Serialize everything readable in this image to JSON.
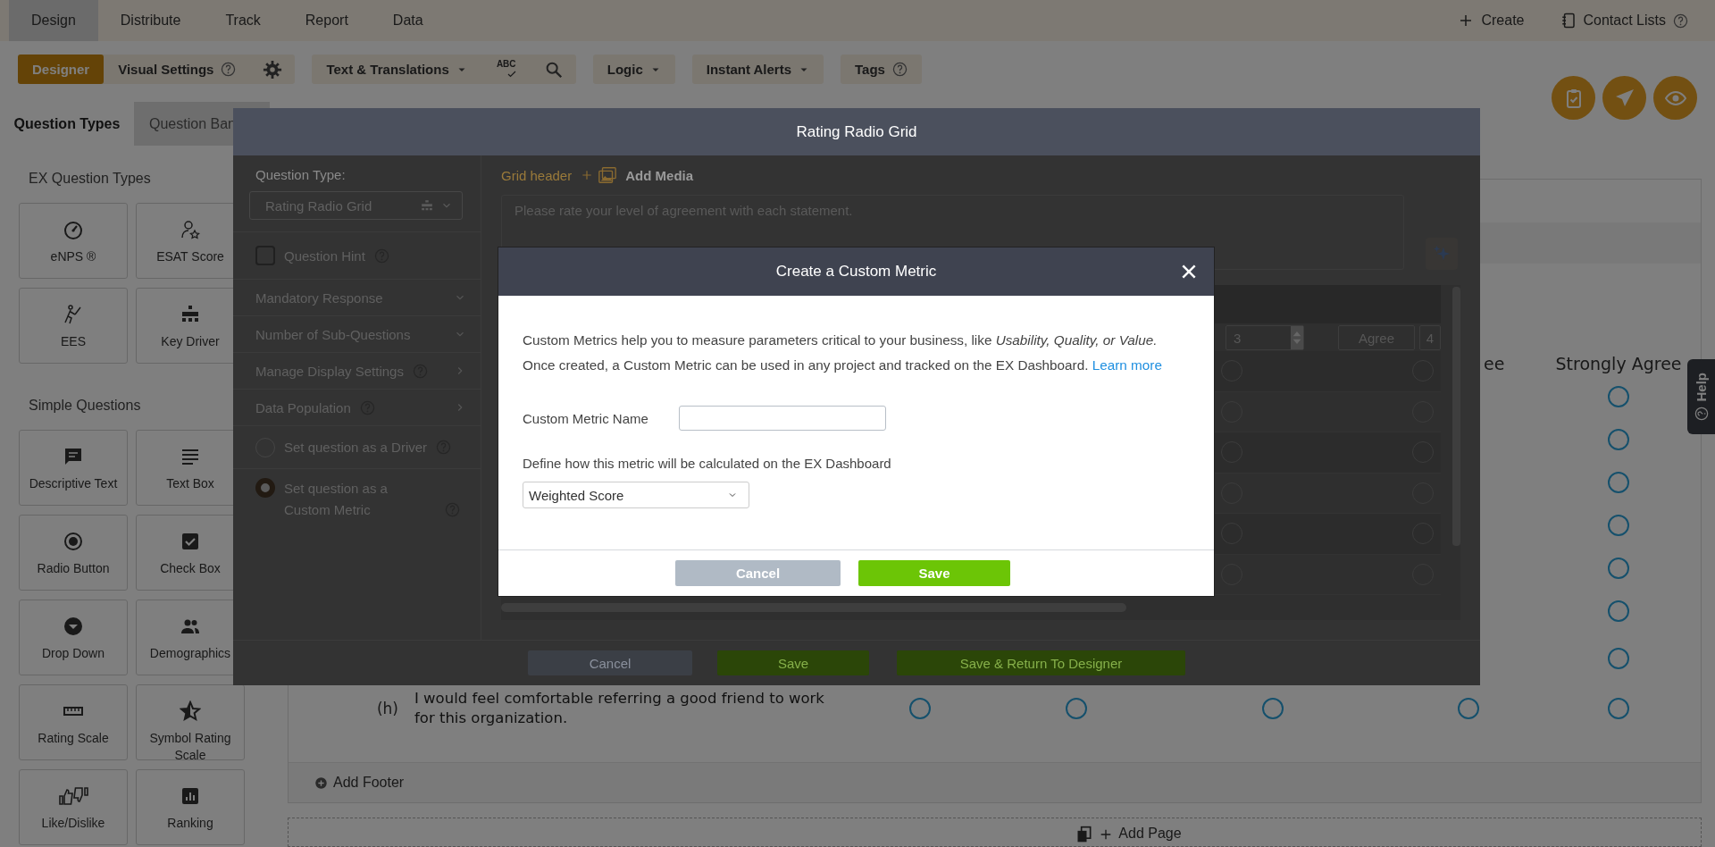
{
  "top_nav": {
    "tabs": [
      {
        "label": "Design",
        "selected": true
      },
      {
        "label": "Distribute",
        "selected": false
      },
      {
        "label": "Track",
        "selected": false
      },
      {
        "label": "Report",
        "selected": false
      },
      {
        "label": "Data",
        "selected": false
      }
    ],
    "actions": [
      {
        "kind": "create",
        "label": "Create"
      },
      {
        "kind": "contacts",
        "label": "Contact Lists",
        "help": true
      }
    ]
  },
  "toolbar": {
    "groups": [
      {
        "items": [
          {
            "kind": "segment",
            "label": "Designer",
            "selected": true
          },
          {
            "kind": "segment",
            "label": "Visual Settings",
            "selected": false,
            "help": true
          },
          {
            "kind": "settings"
          }
        ]
      },
      {
        "items": [
          {
            "kind": "menu",
            "label": "Text & Translations"
          },
          {
            "kind": "spellcheck",
            "label": "ABC"
          },
          {
            "kind": "find"
          }
        ]
      },
      {
        "items": [
          {
            "kind": "menu",
            "label": "Logic"
          }
        ]
      },
      {
        "items": [
          {
            "kind": "menu",
            "label": "Instant Alerts"
          }
        ]
      },
      {
        "items": [
          {
            "kind": "plain",
            "label": "Tags",
            "help": true
          }
        ]
      }
    ]
  },
  "floating_actions": [
    {
      "kind": "review"
    },
    {
      "kind": "send"
    },
    {
      "kind": "preview"
    }
  ],
  "sidebar": {
    "tabs": [
      {
        "label": "Question Types",
        "selected": true
      },
      {
        "label": "Question Ban",
        "selected": false
      }
    ],
    "sections": [
      {
        "title": "EX Question Types",
        "items": [
          {
            "kind": "enps",
            "label": "eNPS ®"
          },
          {
            "kind": "esat",
            "label": "ESAT Score"
          },
          {
            "kind": "ees",
            "label": "EES"
          },
          {
            "kind": "key_driver",
            "label": "Key Driver"
          }
        ]
      },
      {
        "title": "Simple Questions",
        "items": [
          {
            "kind": "descriptive_text",
            "label": "Descriptive Text"
          },
          {
            "kind": "text_box",
            "label": "Text Box"
          },
          {
            "kind": "radio_button",
            "label": "Radio Button"
          },
          {
            "kind": "check_box",
            "label": "Check Box"
          },
          {
            "kind": "drop_down",
            "label": "Drop Down"
          },
          {
            "kind": "demographics",
            "label": "Demographics"
          },
          {
            "kind": "rating_scale",
            "label": "Rating Scale"
          },
          {
            "kind": "symbol_rating",
            "label": "Symbol Rating Scale"
          },
          {
            "kind": "like_dislike",
            "label": "Like/Dislike"
          },
          {
            "kind": "ranking",
            "label": "Ranking"
          }
        ]
      }
    ]
  },
  "survey_grid": {
    "columns": [
      {
        "kind": "covered"
      },
      {
        "kind": "covered"
      },
      {
        "kind": "covered"
      },
      {
        "kind": "partial",
        "label": "ee"
      },
      {
        "kind": "labeled",
        "label": "Strongly Agree"
      }
    ],
    "rows": [
      {
        "kind": "covered",
        "choices": [
          {
            "selected": false
          }
        ]
      },
      {
        "kind": "covered",
        "choices": [
          {
            "selected": false
          }
        ]
      },
      {
        "kind": "covered",
        "choices": [
          {
            "selected": false
          }
        ]
      },
      {
        "kind": "covered",
        "choices": [
          {
            "selected": false
          }
        ]
      },
      {
        "kind": "covered",
        "choices": [
          {
            "selected": false
          }
        ]
      },
      {
        "kind": "covered",
        "choices": [
          {
            "selected": false
          }
        ]
      },
      {
        "kind": "covered",
        "choices": [
          {
            "selected": false
          }
        ]
      },
      {
        "kind": "full",
        "letter": "(h)",
        "statement": "I would feel comfortable referring a good friend to work for this organization.",
        "choices": [
          {
            "selected": false
          },
          {
            "selected": false
          },
          {
            "selected": false
          },
          {
            "selected": false
          },
          {
            "selected": false
          }
        ]
      }
    ],
    "add_footer": "Add Footer"
  },
  "add_page": "Add Page",
  "help_tab": "Help",
  "editor_dialog": {
    "title": "Rating Radio Grid",
    "question_type_label": "Question Type:",
    "question_type": "Rating Radio Grid",
    "options": [
      {
        "kind": "checkbox",
        "label": "Question Hint",
        "checked": false,
        "help": true
      },
      {
        "kind": "dropdown",
        "label": "Mandatory Response"
      },
      {
        "kind": "dropdown",
        "label": "Number of Sub-Questions"
      },
      {
        "kind": "submenu",
        "label": "Manage Display Settings",
        "help": true
      },
      {
        "kind": "submenu",
        "label": "Data Population",
        "help": true
      },
      {
        "kind": "radio",
        "label": "Set question as a Driver",
        "selected": false,
        "help": true
      },
      {
        "kind": "radio",
        "label": "Set question as a Custom Metric",
        "selected": true,
        "help": true
      }
    ],
    "grid_header_label": "Grid header",
    "add_media": "Add Media",
    "header_text": "Please rate your level of agreement with each statement.",
    "scale_fields": [
      {
        "kind": "number",
        "value": "3"
      },
      {
        "kind": "text",
        "value": "Agree"
      },
      {
        "kind": "text",
        "value": "4"
      }
    ],
    "grid_rows": [
      {
        "choices": [
          {
            "selected": false
          },
          {
            "selected": false
          }
        ]
      },
      {
        "choices": [
          {
            "selected": false
          },
          {
            "selected": false
          }
        ]
      },
      {
        "choices": [
          {
            "selected": false
          },
          {
            "selected": false
          }
        ]
      },
      {
        "choices": [
          {
            "selected": false
          },
          {
            "selected": false
          }
        ]
      },
      {
        "choices": [
          {
            "selected": false
          },
          {
            "selected": false
          }
        ]
      },
      {
        "choices": [
          {
            "selected": false
          },
          {
            "selected": false
          }
        ]
      }
    ],
    "buttons": [
      {
        "kind": "cancel",
        "label": "Cancel"
      },
      {
        "kind": "save",
        "label": "Save"
      },
      {
        "kind": "save_return",
        "label": "Save & Return To Designer"
      }
    ]
  },
  "metric_dialog": {
    "title": "Create a Custom Metric",
    "intro": "Custom Metrics help you to measure parameters critical to your business, like *Usability, Quality, or Value.*",
    "detail": "Once created, a Custom Metric can be used in any project and tracked on the EX Dashboard.",
    "link": "Learn more",
    "name_label": "Custom Metric Name",
    "calc_label": "Define how this metric will be calculated on the EX Dashboard",
    "calc_value": "Weighted Score",
    "buttons": [
      {
        "kind": "cancel",
        "label": "Cancel"
      },
      {
        "kind": "save",
        "label": "Save"
      }
    ]
  }
}
